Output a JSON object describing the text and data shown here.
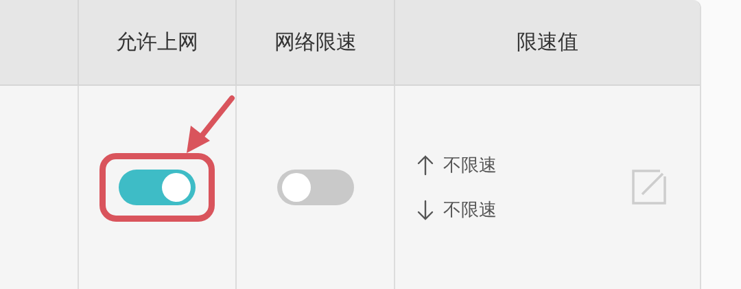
{
  "table": {
    "columns": [
      "允许上网",
      "网络限速",
      "限速值"
    ],
    "rows": [
      {
        "internet_allowed": {
          "on": true,
          "highlighted": true
        },
        "speed_limit": {
          "on": false
        },
        "limit_value": {
          "upload": "不限速",
          "download": "不限速"
        }
      }
    ]
  }
}
